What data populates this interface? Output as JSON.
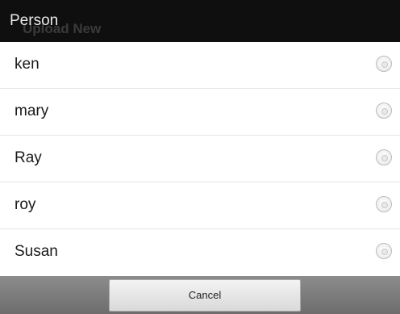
{
  "dialog": {
    "title": "Person",
    "background_text": "Upload New",
    "options": [
      {
        "label": "ken",
        "selected": false
      },
      {
        "label": "mary",
        "selected": false
      },
      {
        "label": "Ray",
        "selected": false
      },
      {
        "label": "roy",
        "selected": false
      },
      {
        "label": "Susan",
        "selected": false
      }
    ],
    "cancel_label": "Cancel"
  },
  "colors": {
    "title_bar": "#0f0f0f",
    "list_background": "#ffffff",
    "footer": "#7a7a7a"
  }
}
